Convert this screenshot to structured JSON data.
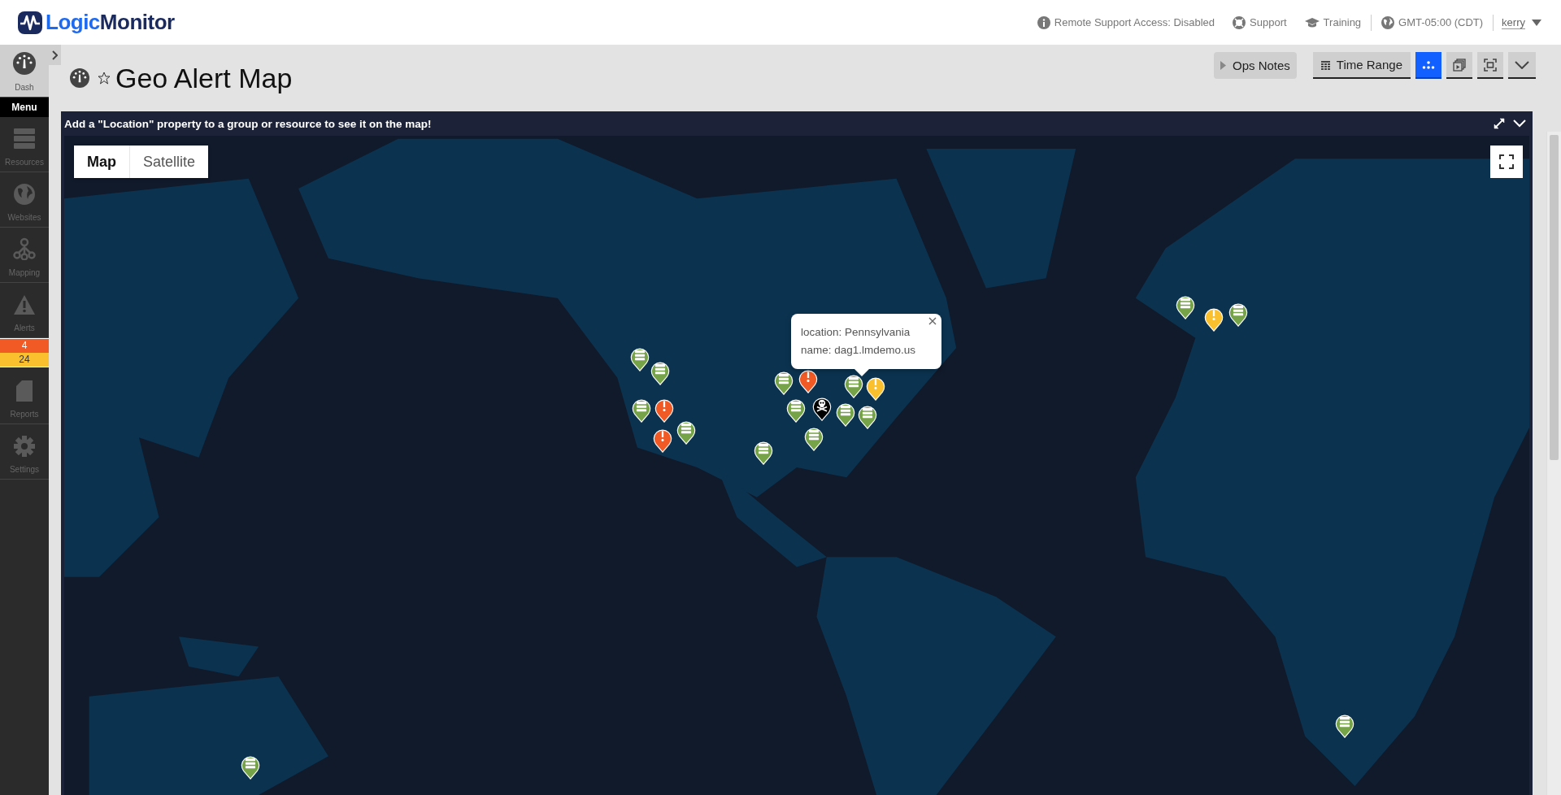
{
  "header": {
    "brand": [
      "Logic",
      "Monitor"
    ],
    "links": [
      {
        "kind": "info",
        "label": "Remote Support Access: Disabled"
      },
      {
        "kind": "support",
        "label": "Support"
      },
      {
        "kind": "training",
        "label": "Training"
      },
      {
        "kind": "timezone",
        "label": "GMT-05:00 (CDT)"
      }
    ],
    "user": "kerry"
  },
  "sidebar": {
    "items": [
      {
        "kind": "dash",
        "label": "Dash",
        "selected": true
      },
      {
        "kind": "resources",
        "label": "Resources",
        "selected": false
      },
      {
        "kind": "websites",
        "label": "Websites",
        "selected": false
      },
      {
        "kind": "mapping",
        "label": "Mapping",
        "selected": false
      },
      {
        "kind": "alerts",
        "label": "Alerts",
        "selected": false
      },
      {
        "kind": "reports",
        "label": "Reports",
        "selected": false
      },
      {
        "kind": "settings",
        "label": "Settings",
        "selected": false
      }
    ],
    "menu_label": "Menu",
    "alert_counts": [
      {
        "value": "4",
        "color": "#f15a24"
      },
      {
        "value": "24",
        "color": "#fbc02d"
      }
    ]
  },
  "page": {
    "title": "Geo Alert Map",
    "favorite": false,
    "toolbar": [
      {
        "kind": "ops_notes",
        "label": "Ops Notes"
      },
      {
        "kind": "time_range",
        "label": "Time Range",
        "selected": false
      },
      {
        "kind": "map_view",
        "selected": true
      },
      {
        "kind": "slideshow",
        "selected": false
      },
      {
        "kind": "fit",
        "selected": false
      },
      {
        "kind": "more",
        "selected": false
      }
    ]
  },
  "widget": {
    "message": "Add a \"Location\" property to a group or resource to see it on the map!",
    "map_types": [
      {
        "label": "Map",
        "selected": true
      },
      {
        "label": "Satellite",
        "selected": false
      }
    ],
    "markers": [
      {
        "kind": "resource",
        "color": "#76a348"
      },
      {
        "kind": "resource",
        "color": "#76a348"
      },
      {
        "kind": "resource",
        "color": "#76a348"
      },
      {
        "kind": "alert",
        "color": "#f15a24"
      },
      {
        "kind": "resource",
        "color": "#76a348"
      },
      {
        "kind": "alert",
        "color": "#f15a24"
      },
      {
        "kind": "resource",
        "color": "#76a348"
      },
      {
        "kind": "alert",
        "color": "#f15a24"
      },
      {
        "kind": "resource",
        "color": "#76a348"
      },
      {
        "kind": "resource",
        "color": "#76a348"
      },
      {
        "kind": "critical",
        "color": "#000000"
      },
      {
        "kind": "resource",
        "color": "#76a348"
      },
      {
        "kind": "resource",
        "color": "#76a348"
      },
      {
        "kind": "alert",
        "color": "#fbc02d"
      },
      {
        "kind": "resource",
        "color": "#76a348"
      },
      {
        "kind": "resource",
        "color": "#76a348"
      },
      {
        "kind": "resource",
        "color": "#76a348"
      },
      {
        "kind": "alert",
        "color": "#fbc02d"
      },
      {
        "kind": "resource",
        "color": "#76a348"
      },
      {
        "kind": "resource",
        "color": "#76a348"
      },
      {
        "kind": "resource",
        "color": "#76a348"
      }
    ],
    "popup": {
      "lines": [
        "location: Pennsylvania",
        "name: dag1.lmdemo.us"
      ]
    }
  }
}
